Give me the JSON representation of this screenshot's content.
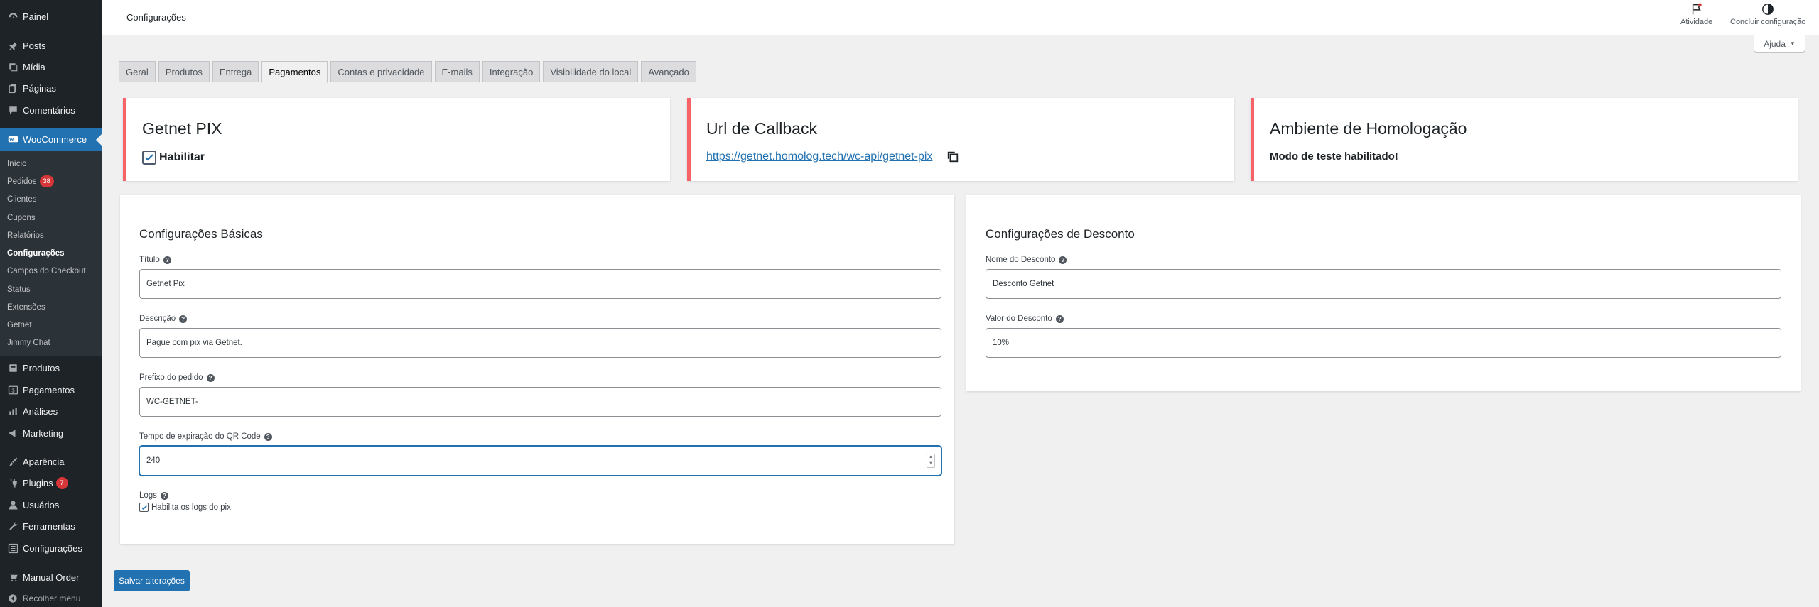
{
  "sidebar": {
    "items": [
      {
        "label": "Painel",
        "icon": "dashboard-icon"
      },
      {
        "label": "Posts",
        "icon": "pin-icon"
      },
      {
        "label": "Mídia",
        "icon": "media-icon"
      },
      {
        "label": "Páginas",
        "icon": "pages-icon"
      },
      {
        "label": "Comentários",
        "icon": "comment-icon"
      },
      {
        "label": "WooCommerce",
        "icon": "woocommerce-icon"
      },
      {
        "label": "Produtos",
        "icon": "products-icon"
      },
      {
        "label": "Pagamentos",
        "icon": "payments-icon"
      },
      {
        "label": "Análises",
        "icon": "analytics-icon"
      },
      {
        "label": "Marketing",
        "icon": "megaphone-icon"
      },
      {
        "label": "Aparência",
        "icon": "brush-icon"
      },
      {
        "label": "Plugins",
        "icon": "plugin-icon",
        "badge": "7"
      },
      {
        "label": "Usuários",
        "icon": "users-icon"
      },
      {
        "label": "Ferramentas",
        "icon": "wrench-icon"
      },
      {
        "label": "Configurações",
        "icon": "settings-icon"
      },
      {
        "label": "Manual Order",
        "icon": "cart-icon"
      }
    ],
    "submenu": [
      {
        "label": "Início"
      },
      {
        "label": "Pedidos",
        "badge": "38"
      },
      {
        "label": "Clientes"
      },
      {
        "label": "Cupons"
      },
      {
        "label": "Relatórios"
      },
      {
        "label": "Configurações"
      },
      {
        "label": "Campos do Checkout"
      },
      {
        "label": "Status"
      },
      {
        "label": "Extensões"
      },
      {
        "label": "Getnet"
      },
      {
        "label": "Jimmy Chat"
      }
    ],
    "collapse_label": "Recolher menu"
  },
  "header": {
    "title": "Configurações",
    "activity_label": "Atividade",
    "finish_setup_label": "Concluir configuração",
    "help_label": "Ajuda"
  },
  "tabs": [
    "Geral",
    "Produtos",
    "Entrega",
    "Pagamentos",
    "Contas e privacidade",
    "E-mails",
    "Integração",
    "Visibilidade do local",
    "Avançado"
  ],
  "active_tab": "Pagamentos",
  "cards": {
    "pix": {
      "title": "Getnet PIX",
      "enable_label": "Habilitar",
      "enabled": true
    },
    "callback": {
      "title": "Url de Callback",
      "url": "https://getnet.homolog.tech/wc-api/getnet-pix"
    },
    "environment": {
      "title": "Ambiente de Homologação",
      "status": "Modo de teste habilitado!"
    }
  },
  "basic_settings": {
    "title": "Configurações Básicas",
    "titulo_label": "Título",
    "titulo_value": "Getnet Pix",
    "descricao_label": "Descrição",
    "descricao_value": "Pague com pix via Getnet.",
    "prefixo_label": "Prefixo do pedido",
    "prefixo_value": "WC-GETNET-",
    "tempo_label": "Tempo de expiração do QR Code",
    "tempo_value": "240",
    "logs_label": "Logs",
    "logs_checkbox_label": "Habilita os logs do pix.",
    "logs_enabled": true
  },
  "discount_settings": {
    "title": "Configurações de Desconto",
    "nome_label": "Nome do Desconto",
    "nome_value": "Desconto Getnet",
    "valor_label": "Valor do Desconto",
    "valor_value": "10%"
  },
  "save_label": "Salvar alterações",
  "colors": {
    "sidebar_bg": "#1d2327",
    "accent": "#2271b1",
    "notice_border": "#f86368",
    "badge": "#d63638"
  }
}
